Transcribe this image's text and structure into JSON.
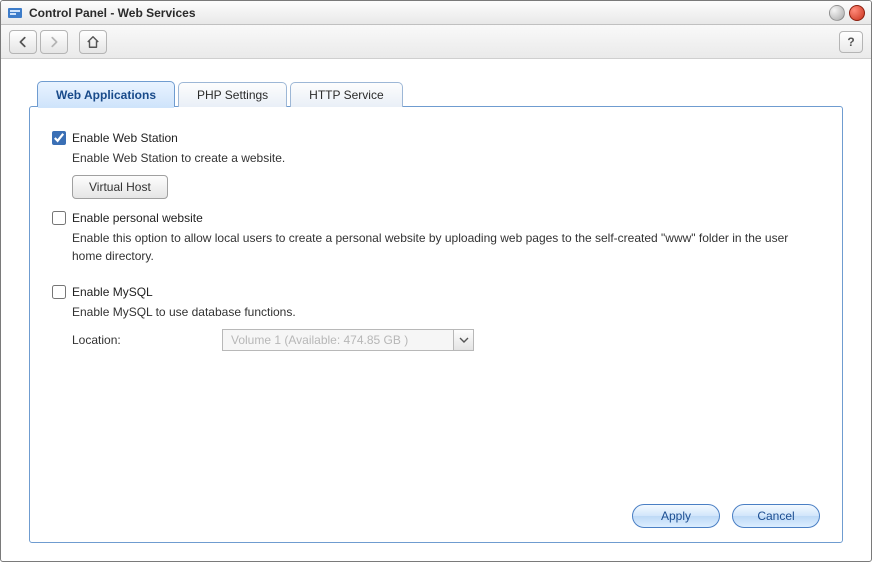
{
  "window": {
    "title": "Control Panel - Web Services"
  },
  "toolbar": {
    "help_label": "?"
  },
  "tabs": [
    {
      "label": "Web Applications",
      "active": true
    },
    {
      "label": "PHP Settings",
      "active": false
    },
    {
      "label": "HTTP Service",
      "active": false
    }
  ],
  "webstation": {
    "checkbox_label": "Enable Web Station",
    "checked": true,
    "description": "Enable Web Station to create a website.",
    "virtual_host_button": "Virtual Host"
  },
  "personal": {
    "checkbox_label": "Enable personal website",
    "checked": false,
    "description": "Enable this option to allow local users to create a personal website by uploading web pages to the self-created \"www\" folder in the user home directory."
  },
  "mysql": {
    "checkbox_label": "Enable MySQL",
    "checked": false,
    "description": "Enable MySQL to use database functions.",
    "location_label": "Location:",
    "location_selected": "Volume 1 (Available: 474.85 GB )",
    "location_disabled": true
  },
  "footer": {
    "apply": "Apply",
    "cancel": "Cancel"
  }
}
